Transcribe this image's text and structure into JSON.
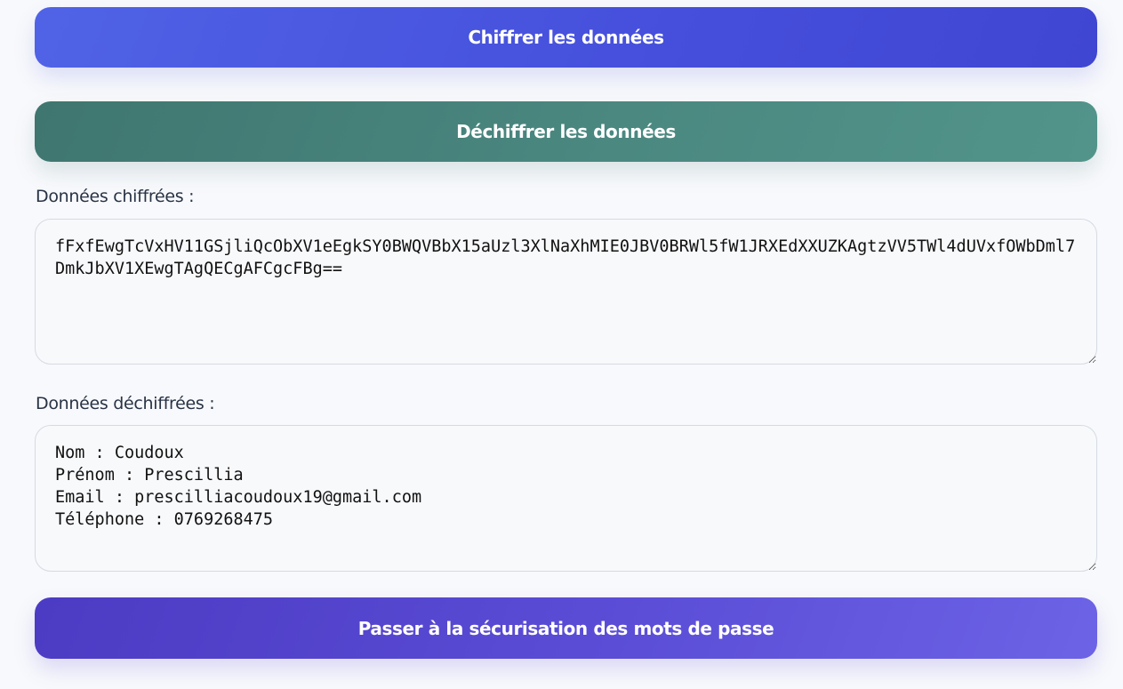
{
  "buttons": {
    "encrypt_label": "Chiffrer les données",
    "decrypt_label": "Déchiffrer les données",
    "next_label": "Passer à la sécurisation des mots de passe"
  },
  "encrypted": {
    "label": "Données chiffrées :",
    "value": "fFxfEwgTcVxHV11GSjliQcObXV1eEgkSY0BWQVBbX15aUzl3XlNaXhMIE0JBV0BRWl5fW1JRXEdXXUZKAgtzVV5TWl4dUVxfOWbDml7DmkJbXV1XEwgTAgQECgAFCgcFBg=="
  },
  "decrypted": {
    "label": "Données déchiffrées :",
    "value": "Nom : Coudoux\nPrénom : Prescillia\nEmail : prescilliacoudoux19@gmail.com\nTéléphone : 0769268475"
  },
  "colors": {
    "encrypt_button": "#4650dc",
    "decrypt_button": "#4a8880",
    "next_button": "#5b4dd6",
    "label_text": "#283345",
    "field_background": "#f8f9fb",
    "field_border": "#d5dae3"
  }
}
